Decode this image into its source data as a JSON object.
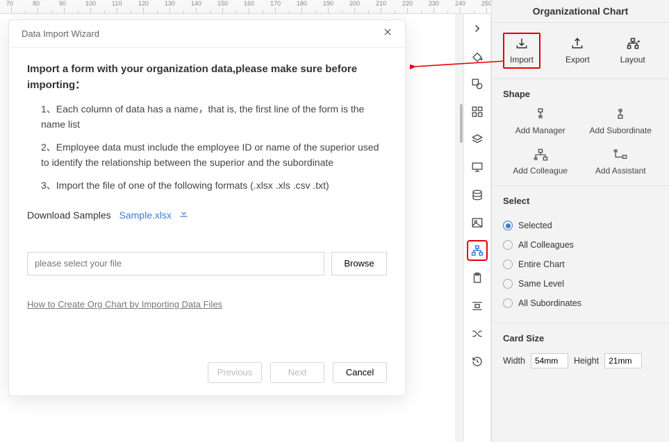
{
  "ruler": {
    "start": 70,
    "step": 10,
    "count": 30
  },
  "panel": {
    "title": "Organizational Chart",
    "actions": {
      "import": "Import",
      "export": "Export",
      "layout": "Layout"
    },
    "shape": {
      "heading": "Shape",
      "add_manager": "Add Manager",
      "add_subordinate": "Add Subordinate",
      "add_colleague": "Add Colleague",
      "add_assistant": "Add Assistant"
    },
    "select": {
      "heading": "Select",
      "options": {
        "selected": "Selected",
        "all_colleagues": "All Colleagues",
        "entire_chart": "Entire Chart",
        "same_level": "Same Level",
        "all_subordinates": "All Subordinates"
      },
      "value": "selected"
    },
    "card_size": {
      "heading": "Card Size",
      "width_label": "Width",
      "width_value": "54mm",
      "height_label": "Height",
      "height_value": "21mm"
    }
  },
  "dialog": {
    "title": "Data Import Wizard",
    "intro": "Import a form with your organization data,please make sure before importing：",
    "steps": {
      "s1": "1、Each column of data has a name，that is, the first line of the form is the name list",
      "s2": "2、Employee data must include the employee ID or name of the superior used to identify the relationship between the superior and the subordinate",
      "s3": "3、Import the file of one of the following formats (.xlsx .xls .csv .txt)"
    },
    "download_label": "Download Samples",
    "sample_link": "Sample.xlsx",
    "file_placeholder": "please select your file",
    "browse": "Browse",
    "howto": "How to Create Org Chart by Importing Data Files",
    "buttons": {
      "previous": "Previous",
      "next": "Next",
      "cancel": "Cancel"
    }
  }
}
